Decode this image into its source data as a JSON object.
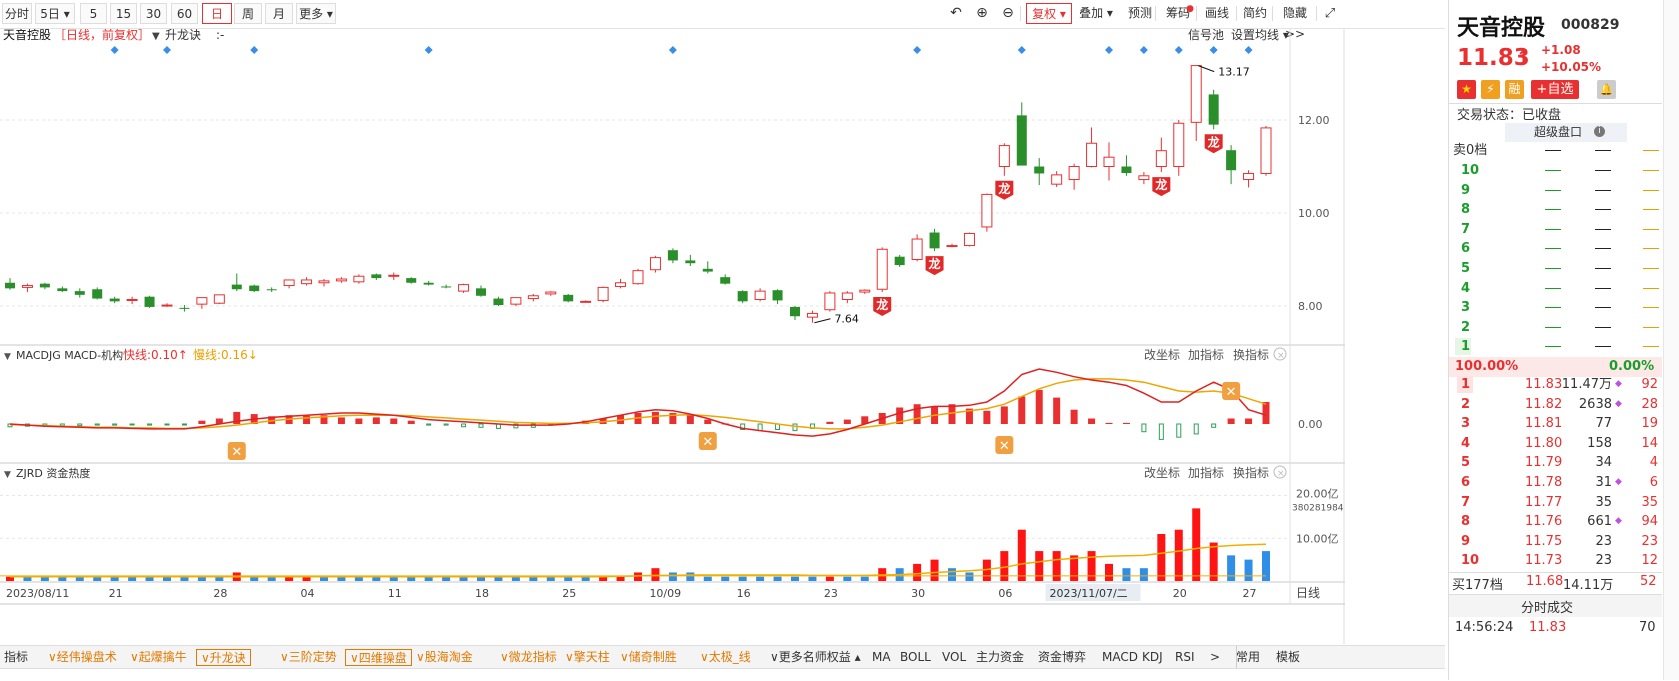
{
  "toolbar": {
    "periods": [
      "分时",
      "5日",
      "5",
      "15",
      "30",
      "60",
      "日",
      "周",
      "月",
      "更多"
    ],
    "active_period": "日",
    "right_buttons": [
      "复权",
      "叠加",
      "预测",
      "筹码",
      "画线",
      "简约",
      "隐藏>>"
    ]
  },
  "header": {
    "stock_name": "天音控股",
    "mode_text": "［日线，前复权］",
    "indicator_name": "升龙诀",
    "indicator_value": ":-",
    "signal_pool": "信号池",
    "set_ma": "设置均线"
  },
  "main_chart": {
    "y_ticks": [
      "12.00",
      "10.00",
      "8.00"
    ],
    "high_label": "13.17",
    "low_label": "7.64",
    "dragon_label": "龙",
    "x_ticks": [
      "2023/08/11",
      "21",
      "28",
      "04",
      "11",
      "18",
      "25",
      "10/09",
      "16",
      "23",
      "30",
      "06",
      "2023/11/07/二",
      "20",
      "27"
    ],
    "crosshair_label": "日线",
    "colors": {
      "up": "#e93030",
      "down": "#2a8f2a",
      "accent": "#e93030"
    }
  },
  "macd_panel": {
    "title": "MACDJG MACD-机构",
    "fast_label": "快线:0.10↑",
    "slow_label": "慢线:0.16↓",
    "zero_label": "0.00",
    "buttons": [
      "改坐标",
      "加指标",
      "换指标"
    ]
  },
  "zjrd_panel": {
    "title": "ZJRD 资金热度",
    "y_top": "20.00亿",
    "y_top2": "380281984",
    "y_mid": "10.00亿",
    "buttons": [
      "改坐标",
      "加指标",
      "换指标"
    ]
  },
  "bottom_tabs": [
    {
      "label": "指标",
      "style": "plain"
    },
    {
      "label": "经伟操盘术",
      "style": "orange"
    },
    {
      "label": "起爆擒牛",
      "style": "orange"
    },
    {
      "label": "升龙诀",
      "style": "orange-boxed"
    },
    {
      "label": "三阶定势",
      "style": "orange"
    },
    {
      "label": "四维操盘",
      "style": "orange-boxed"
    },
    {
      "label": "股海淘金",
      "style": "orange"
    },
    {
      "label": "微龙指标",
      "style": "orange"
    },
    {
      "label": "擎天柱",
      "style": "orange"
    },
    {
      "label": "储奇制胜",
      "style": "orange"
    },
    {
      "label": "太极_线",
      "style": "orange"
    },
    {
      "label": "更多名师权益",
      "style": "plain"
    },
    {
      "label": "MA",
      "style": "plain"
    },
    {
      "label": "BOLL",
      "style": "plain"
    },
    {
      "label": "VOL",
      "style": "plain"
    },
    {
      "label": "主力资金",
      "style": "plain"
    },
    {
      "label": "资金博弈",
      "style": "plain"
    },
    {
      "label": "MACD",
      "style": "plain"
    },
    {
      "label": "KDJ",
      "style": "plain"
    },
    {
      "label": "RSI",
      "style": "plain"
    },
    {
      "label": ">",
      "style": "plain"
    },
    {
      "label": "常用",
      "style": "plain"
    },
    {
      "label": "模板",
      "style": "plain"
    }
  ],
  "quote": {
    "name": "天音控股",
    "code": "000829",
    "price": "11.83",
    "arrow": "↑",
    "change": "+1.08",
    "change_pct": "+10.05%",
    "badges": [
      "融",
      "+自选"
    ],
    "status_label": "交易状态：已收盘",
    "super_book": "超级盘口",
    "sell_header": "卖0档",
    "sell_levels": [
      "10",
      "9",
      "8",
      "7",
      "6",
      "5",
      "4",
      "3",
      "2",
      "1"
    ],
    "ratio_left": "100.00%",
    "ratio_right": "0.00%",
    "buy_levels": [
      {
        "lvl": "1",
        "price": "11.83",
        "vol": "11.47万",
        "count": "92"
      },
      {
        "lvl": "2",
        "price": "11.82",
        "vol": "2638",
        "count": "28"
      },
      {
        "lvl": "3",
        "price": "11.81",
        "vol": "77",
        "count": "19"
      },
      {
        "lvl": "4",
        "price": "11.80",
        "vol": "158",
        "count": "14"
      },
      {
        "lvl": "5",
        "price": "11.79",
        "vol": "34",
        "count": "4"
      },
      {
        "lvl": "6",
        "price": "11.78",
        "vol": "31",
        "count": "6"
      },
      {
        "lvl": "7",
        "price": "11.77",
        "vol": "35",
        "count": "35"
      },
      {
        "lvl": "8",
        "price": "11.76",
        "vol": "661",
        "count": "94"
      },
      {
        "lvl": "9",
        "price": "11.75",
        "vol": "23",
        "count": "23"
      },
      {
        "lvl": "10",
        "price": "11.73",
        "vol": "23",
        "count": "12"
      }
    ],
    "buy_total": {
      "label": "买177档",
      "price": "11.68",
      "vol": "14.11万",
      "count": "52"
    },
    "trades_title": "分时成交",
    "last_trade": {
      "time": "14:56:24",
      "price": "11.83",
      "vol": "70"
    }
  },
  "chart_data": {
    "type": "candlestick",
    "candles": [
      [
        8.5,
        8.6,
        8.35,
        8.38
      ],
      [
        8.4,
        8.48,
        8.3,
        8.44
      ],
      [
        8.48,
        8.5,
        8.36,
        8.4
      ],
      [
        8.38,
        8.42,
        8.3,
        8.32
      ],
      [
        8.32,
        8.38,
        8.18,
        8.24
      ],
      [
        8.36,
        8.4,
        8.14,
        8.16
      ],
      [
        8.16,
        8.2,
        8.06,
        8.1
      ],
      [
        8.14,
        8.2,
        8.04,
        8.14
      ],
      [
        8.2,
        8.22,
        7.96,
        7.98
      ],
      [
        8.02,
        8.06,
        7.98,
        8.02
      ],
      [
        7.96,
        8.02,
        7.88,
        7.94
      ],
      [
        8.04,
        8.16,
        7.94,
        8.18
      ],
      [
        8.06,
        8.22,
        8.04,
        8.24
      ],
      [
        8.46,
        8.7,
        8.32,
        8.36
      ],
      [
        8.44,
        8.46,
        8.3,
        8.32
      ],
      [
        8.36,
        8.4,
        8.3,
        8.34
      ],
      [
        8.44,
        8.56,
        8.38,
        8.56
      ],
      [
        8.48,
        8.62,
        8.44,
        8.56
      ],
      [
        8.5,
        8.58,
        8.42,
        8.54
      ],
      [
        8.54,
        8.62,
        8.5,
        8.58
      ],
      [
        8.52,
        8.68,
        8.48,
        8.64
      ],
      [
        8.68,
        8.7,
        8.56,
        8.6
      ],
      [
        8.64,
        8.72,
        8.56,
        8.66
      ],
      [
        8.6,
        8.62,
        8.48,
        8.5
      ],
      [
        8.5,
        8.54,
        8.44,
        8.46
      ],
      [
        8.42,
        8.46,
        8.38,
        8.4
      ],
      [
        8.32,
        8.48,
        8.28,
        8.46
      ],
      [
        8.38,
        8.44,
        8.2,
        8.22
      ],
      [
        8.16,
        8.2,
        8.0,
        8.02
      ],
      [
        8.04,
        8.18,
        8.0,
        8.18
      ],
      [
        8.16,
        8.26,
        8.1,
        8.22
      ],
      [
        8.26,
        8.32,
        8.22,
        8.3
      ],
      [
        8.24,
        8.26,
        8.08,
        8.1
      ],
      [
        8.1,
        8.12,
        8.08,
        8.1
      ],
      [
        8.12,
        8.42,
        8.08,
        8.4
      ],
      [
        8.42,
        8.58,
        8.38,
        8.5
      ],
      [
        8.48,
        8.8,
        8.46,
        8.76
      ],
      [
        8.78,
        9.08,
        8.72,
        9.04
      ],
      [
        9.2,
        9.24,
        8.92,
        8.98
      ],
      [
        8.98,
        9.1,
        8.86,
        8.92
      ],
      [
        8.8,
        8.96,
        8.7,
        8.74
      ],
      [
        8.62,
        8.68,
        8.46,
        8.48
      ],
      [
        8.32,
        8.34,
        8.06,
        8.1
      ],
      [
        8.14,
        8.38,
        8.1,
        8.32
      ],
      [
        8.34,
        8.36,
        8.04,
        8.12
      ],
      [
        7.98,
        8.0,
        7.7,
        7.78
      ],
      [
        7.76,
        7.9,
        7.64,
        7.84
      ],
      [
        7.92,
        8.32,
        7.88,
        8.28
      ],
      [
        8.14,
        8.32,
        8.06,
        8.28
      ],
      [
        8.3,
        8.36,
        8.26,
        8.34
      ],
      [
        8.36,
        9.26,
        8.3,
        9.22
      ],
      [
        9.06,
        9.1,
        8.84,
        8.88
      ],
      [
        9.0,
        9.54,
        8.96,
        9.44
      ],
      [
        9.58,
        9.66,
        9.18,
        9.24
      ],
      [
        9.3,
        9.34,
        9.26,
        9.3
      ],
      [
        9.3,
        9.58,
        9.28,
        9.56
      ],
      [
        9.7,
        10.42,
        9.6,
        10.4
      ],
      [
        11.0,
        11.5,
        10.8,
        11.45
      ],
      [
        12.1,
        12.38,
        11.05,
        11.02
      ],
      [
        11.0,
        11.18,
        10.6,
        10.85
      ],
      [
        10.62,
        10.9,
        10.56,
        10.82
      ],
      [
        10.72,
        11.06,
        10.5,
        11.0
      ],
      [
        11.0,
        11.84,
        10.98,
        11.5
      ],
      [
        11.0,
        11.52,
        10.7,
        11.2
      ],
      [
        11.0,
        11.24,
        10.8,
        10.86
      ],
      [
        10.72,
        10.88,
        10.62,
        10.8
      ],
      [
        11.0,
        11.62,
        10.88,
        11.34
      ],
      [
        11.0,
        12.0,
        10.8,
        11.93
      ],
      [
        11.95,
        13.17,
        11.55,
        13.17
      ],
      [
        12.55,
        12.65,
        11.8,
        11.9
      ],
      [
        11.35,
        11.46,
        10.62,
        10.92
      ],
      [
        10.72,
        10.92,
        10.55,
        10.85
      ],
      [
        10.85,
        11.87,
        10.8,
        11.83
      ]
    ],
    "ylim": [
      7.2,
      13.6
    ],
    "y_ticks": [
      8.0,
      10.0,
      12.0
    ],
    "signal_markers": [
      6,
      9,
      14,
      24,
      38,
      52,
      58,
      63,
      65,
      67,
      69,
      71
    ],
    "dragon_markers": [
      50,
      53,
      57,
      66,
      69
    ],
    "macd_hist": [
      -0.05,
      -0.04,
      -0.04,
      -0.03,
      -0.03,
      -0.02,
      -0.02,
      -0.01,
      -0.02,
      -0.01,
      -0.01,
      0.06,
      0.1,
      0.22,
      0.18,
      0.14,
      0.16,
      0.15,
      0.16,
      0.12,
      0.1,
      0.12,
      0.1,
      0.06,
      -0.02,
      -0.02,
      -0.05,
      -0.06,
      -0.08,
      -0.07,
      -0.06,
      -0.02,
      0.02,
      0.06,
      0.1,
      0.16,
      0.2,
      0.22,
      0.2,
      0.16,
      0.08,
      0.01,
      -0.1,
      -0.12,
      -0.1,
      -0.12,
      -0.08,
      0.04,
      0.08,
      0.14,
      0.2,
      0.3,
      0.36,
      0.32,
      0.36,
      0.28,
      0.24,
      0.32,
      0.5,
      0.62,
      0.48,
      0.26,
      0.1,
      0.02,
      0.02,
      -0.14,
      -0.28,
      -0.24,
      -0.18,
      -0.06,
      0.1,
      0.1,
      0.4
    ],
    "macd_fast": [
      0.0,
      -0.02,
      -0.04,
      -0.05,
      -0.06,
      -0.07,
      -0.07,
      -0.08,
      -0.09,
      -0.09,
      -0.09,
      -0.05,
      0.0,
      0.05,
      0.09,
      0.12,
      0.14,
      0.16,
      0.18,
      0.2,
      0.2,
      0.18,
      0.16,
      0.12,
      0.08,
      0.06,
      0.04,
      0.02,
      0.0,
      -0.02,
      -0.02,
      -0.02,
      0.0,
      0.04,
      0.1,
      0.16,
      0.22,
      0.26,
      0.24,
      0.18,
      0.1,
      0.0,
      -0.08,
      -0.12,
      -0.16,
      -0.2,
      -0.22,
      -0.18,
      -0.1,
      0.0,
      0.1,
      0.2,
      0.28,
      0.32,
      0.32,
      0.34,
      0.4,
      0.6,
      0.9,
      1.0,
      0.94,
      0.86,
      0.8,
      0.76,
      0.7,
      0.56,
      0.4,
      0.4,
      0.6,
      0.76,
      0.62,
      0.26,
      0.16
    ],
    "macd_slow": [
      -0.01,
      -0.02,
      -0.03,
      -0.04,
      -0.05,
      -0.06,
      -0.06,
      -0.07,
      -0.07,
      -0.08,
      -0.08,
      -0.07,
      -0.05,
      -0.02,
      0.02,
      0.06,
      0.09,
      0.11,
      0.13,
      0.15,
      0.16,
      0.16,
      0.16,
      0.15,
      0.13,
      0.11,
      0.09,
      0.07,
      0.05,
      0.03,
      0.02,
      0.01,
      0.01,
      0.02,
      0.04,
      0.07,
      0.11,
      0.14,
      0.16,
      0.17,
      0.15,
      0.12,
      0.08,
      0.04,
      0.0,
      -0.04,
      -0.07,
      -0.09,
      -0.09,
      -0.06,
      -0.02,
      0.04,
      0.1,
      0.16,
      0.2,
      0.24,
      0.28,
      0.36,
      0.5,
      0.64,
      0.74,
      0.8,
      0.82,
      0.82,
      0.8,
      0.76,
      0.68,
      0.6,
      0.58,
      0.6,
      0.56,
      0.46,
      0.36
    ],
    "zjrd_values": [
      1,
      1,
      1,
      1,
      1,
      1,
      1,
      1,
      1,
      1,
      1,
      1,
      1,
      2,
      1,
      1,
      1,
      1,
      1,
      1,
      1,
      1,
      1,
      1,
      1,
      1,
      1,
      1,
      1,
      1,
      1,
      1,
      1,
      1,
      1,
      1,
      2,
      3,
      2,
      2,
      1,
      1,
      1,
      1,
      1,
      1,
      1,
      1,
      1,
      1,
      3,
      3,
      4,
      5,
      3,
      2,
      5,
      7,
      12,
      7,
      7,
      6,
      7,
      4,
      3,
      3,
      11,
      12,
      17,
      9,
      6,
      5,
      7
    ],
    "zjrd_up": [
      1,
      0,
      0,
      0,
      0,
      0,
      0,
      0,
      0,
      0,
      0,
      0,
      0,
      1,
      0,
      0,
      1,
      1,
      0,
      0,
      0,
      0,
      0,
      0,
      0,
      0,
      0,
      0,
      0,
      0,
      0,
      0,
      0,
      0,
      1,
      1,
      1,
      1,
      0,
      0,
      0,
      0,
      0,
      0,
      0,
      0,
      0,
      1,
      0,
      0,
      1,
      0,
      1,
      1,
      0,
      0,
      1,
      1,
      1,
      1,
      1,
      1,
      1,
      1,
      0,
      0,
      1,
      1,
      1,
      1,
      0,
      0,
      0
    ],
    "zjrd_ma": [
      1.0,
      1.0,
      1.0,
      1.0,
      1.0,
      1.0,
      1.0,
      1.0,
      1.0,
      1.0,
      1.0,
      1.0,
      1.0,
      1.0,
      1.0,
      1.0,
      1.0,
      1.0,
      1.0,
      1.0,
      1.0,
      1.0,
      1.0,
      1.0,
      1.0,
      1.0,
      1.0,
      1.0,
      1.0,
      1.0,
      1.0,
      1.0,
      1.0,
      1.0,
      1.0,
      1.1,
      1.2,
      1.3,
      1.3,
      1.4,
      1.4,
      1.4,
      1.4,
      1.4,
      1.4,
      1.4,
      1.3,
      1.3,
      1.3,
      1.3,
      1.4,
      1.5,
      1.7,
      2.0,
      2.2,
      2.4,
      2.7,
      3.2,
      4.0,
      4.5,
      5.0,
      5.3,
      5.6,
      5.8,
      5.9,
      6.0,
      6.5,
      7.0,
      7.6,
      8.0,
      8.3,
      8.5,
      8.6
    ],
    "zjrd_ylim": [
      0,
      22
    ]
  }
}
